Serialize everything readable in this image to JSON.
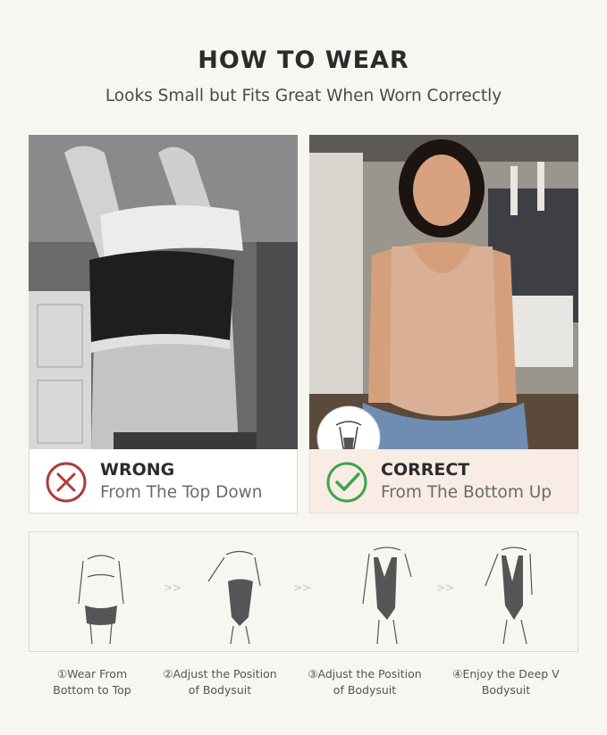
{
  "header": {
    "title": "HOW TO WEAR",
    "subtitle": "Looks Small but Fits Great When Worn Correctly"
  },
  "comparison": {
    "wrong": {
      "icon": "x-circle-icon",
      "color": "#b23a3a",
      "heading": "WRONG",
      "subheading": "From The Top Down"
    },
    "correct": {
      "icon": "check-circle-icon",
      "color": "#3aa64a",
      "heading": "CORRECT",
      "subheading": "From The Bottom Up"
    }
  },
  "steps": [
    {
      "line1": "①Wear From",
      "line2": "Bottom to Top"
    },
    {
      "line1": "②Adjust the Position",
      "line2": "of Bodysuit"
    },
    {
      "line1": "③Adjust the Position",
      "line2": "of Bodysuit"
    },
    {
      "line1": "④Enjoy the Deep V",
      "line2": "Bodysuit"
    }
  ],
  "separator_glyph": ">>"
}
